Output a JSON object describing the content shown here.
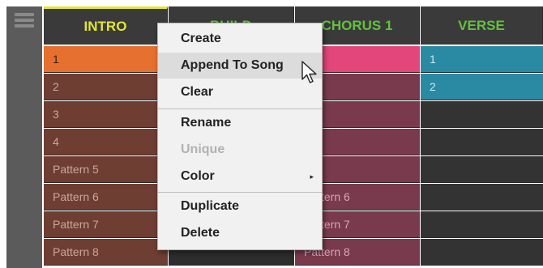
{
  "scenes": [
    {
      "label": "INTRO",
      "selected": true
    },
    {
      "label": "BUILD",
      "selected": false
    },
    {
      "label": "CHORUS 1",
      "selected": false
    },
    {
      "label": "VERSE",
      "selected": false
    }
  ],
  "patterns": {
    "intro": [
      "1",
      "2",
      "3",
      "4",
      "Pattern 5",
      "Pattern 6",
      "Pattern 7",
      "Pattern 8"
    ],
    "chorus": [
      "",
      "",
      "",
      "",
      "",
      "Pattern 6",
      "Pattern 7",
      "Pattern 8"
    ],
    "verse": [
      "1",
      "2"
    ]
  },
  "context_menu": {
    "items": [
      {
        "label": "Create",
        "enabled": true
      },
      {
        "label": "Append To Song",
        "enabled": true,
        "hovered": true
      },
      {
        "label": "Clear",
        "enabled": true
      },
      {
        "label": "Rename",
        "enabled": true
      },
      {
        "label": "Unique",
        "enabled": false
      },
      {
        "label": "Color",
        "enabled": true,
        "has_submenu": true
      },
      {
        "label": "Duplicate",
        "enabled": true
      },
      {
        "label": "Delete",
        "enabled": true
      }
    ],
    "submenu_arrow": "▸"
  },
  "colors": {
    "intro_accent": "#e4e62d",
    "scene_label": "#62c23a",
    "intro_pattern_active": "#e5702f",
    "chorus_pattern_active": "#e2467a",
    "verse_pattern_active": "#2b8aa3"
  },
  "icons": {
    "sidebar": "hamburger-menu-icon",
    "cursor": "mouse-pointer-icon"
  }
}
